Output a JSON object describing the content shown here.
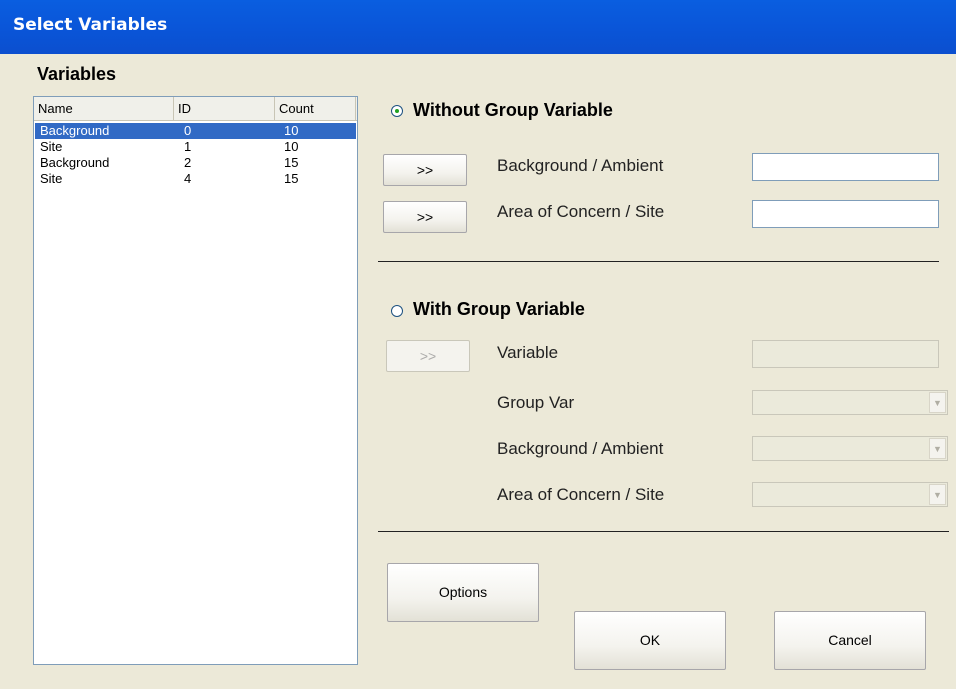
{
  "window": {
    "title": "Select Variables"
  },
  "variables": {
    "title": "Variables",
    "columns": [
      "Name",
      "ID",
      "Count"
    ],
    "rows": [
      {
        "name": "Background",
        "id": "0",
        "count": "10",
        "selected": true
      },
      {
        "name": "Site",
        "id": "1",
        "count": "10",
        "selected": false
      },
      {
        "name": "Background",
        "id": "2",
        "count": "15",
        "selected": false
      },
      {
        "name": "Site",
        "id": "4",
        "count": "15",
        "selected": false
      }
    ]
  },
  "without_group": {
    "label": "Without Group Variable",
    "selected": true,
    "arrow_label": ">>",
    "background_label": "Background / Ambient",
    "background_value": "",
    "site_label": "Area of Concern / Site",
    "site_value": ""
  },
  "with_group": {
    "label": "With Group Variable",
    "selected": false,
    "arrow_label": ">>",
    "variable_label": "Variable",
    "variable_value": "",
    "group_var_label": "Group Var",
    "background_label": "Background / Ambient",
    "site_label": "Area of Concern / Site",
    "combo_arrow": "▼"
  },
  "buttons": {
    "options": "Options",
    "ok": "OK",
    "cancel": "Cancel"
  }
}
